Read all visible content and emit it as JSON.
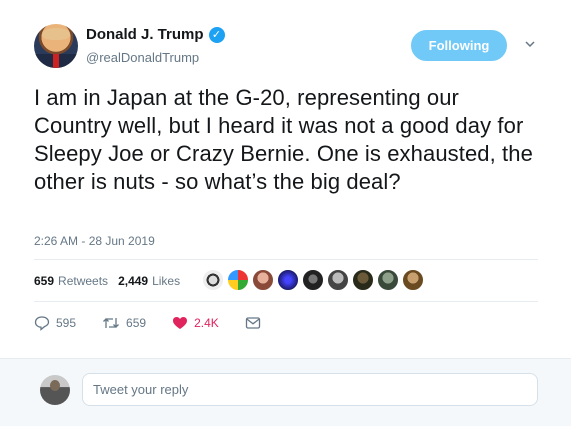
{
  "author": {
    "name": "Donald J. Trump",
    "handle": "@realDonaldTrump",
    "verified_icon": "verified-badge-icon"
  },
  "follow_button": {
    "label": "Following"
  },
  "tweet": {
    "text": "I am in Japan at the G-20, representing our Country well, but I heard it was not a good day for Sleepy Joe or Crazy Bernie. One is exhausted, the other is nuts - so what’s the big deal?",
    "timestamp": "2:26 AM - 28 Jun 2019"
  },
  "stats": {
    "retweets_count": "659",
    "retweets_label": "Retweets",
    "likes_count": "2,449",
    "likes_label": "Likes"
  },
  "actions": {
    "reply_count": "595",
    "retweet_count": "659",
    "like_count": "2.4K"
  },
  "reply": {
    "placeholder": "Tweet your reply"
  },
  "colors": {
    "accent": "#1da1f2",
    "follow_bg": "#71c9f8",
    "like": "#e0245e",
    "muted": "#657786"
  }
}
